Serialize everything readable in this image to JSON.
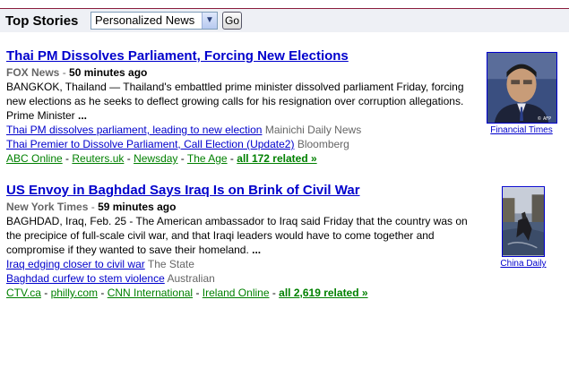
{
  "header": {
    "title": "Top Stories",
    "edition_select": "Personalized News",
    "go_label": "Go"
  },
  "stories": [
    {
      "title": "Thai PM Dissolves Parliament, Forcing New Elections",
      "source": "FOX News",
      "separator": " - ",
      "age": "50 minutes ago",
      "snippet": "BANGKOK, Thailand — Thailand's embattled prime minister dissolved parliament Friday, forcing new elections as he seeks to deflect growing calls for his resignation over corruption allegations. Prime Minister ",
      "ellipsis": "...",
      "related": [
        {
          "link": "Thai PM dissolves parliament, leading to new election",
          "source": "Mainichi Daily News"
        },
        {
          "link": "Thai Premier to Dissolve Parliament, Call Election (Update2)",
          "source": "Bloomberg"
        }
      ],
      "sources": [
        "ABC Online",
        "Reuters.uk",
        "Newsday",
        "The Age"
      ],
      "all_related": "all 172 related »",
      "thumb_caption": "Financial Times",
      "thumb_watermark": "© AFP"
    },
    {
      "title": "US Envoy in Baghdad Says Iraq Is on Brink of Civil War",
      "source": "New York Times",
      "separator": " - ",
      "age": "59 minutes ago",
      "snippet": "BAGHDAD, Iraq, Feb. 25 - The American ambassador to Iraq said Friday that the country was on the precipice of full-scale civil war, and that Iraqi leaders would have to come together and compromise if they wanted to save their homeland. ",
      "ellipsis": "...",
      "related": [
        {
          "link": "Iraq edging closer to civil war",
          "source": "The State"
        },
        {
          "link": "Baghdad curfew to stem violence",
          "source": "Australian"
        }
      ],
      "sources": [
        "CTV.ca",
        "philly.com",
        "CNN International",
        "Ireland Online"
      ],
      "all_related": "all 2,619 related »",
      "thumb_caption": "China Daily"
    }
  ],
  "colors": {
    "link": "#0000cc",
    "source_link": "#008000",
    "muted": "#666666",
    "header_border": "#8a1c3c"
  }
}
